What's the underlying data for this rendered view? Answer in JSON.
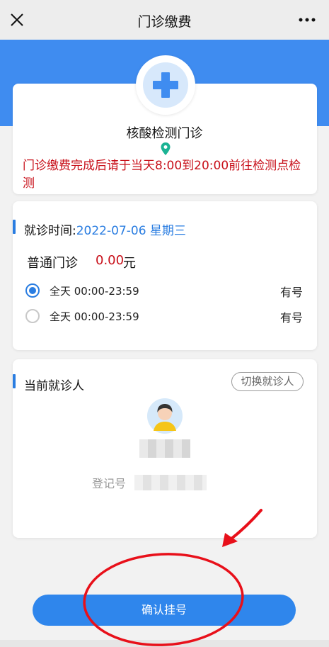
{
  "navbar": {
    "title": "门诊缴费",
    "close_icon": "close-icon",
    "more_icon": "more-icon"
  },
  "hospital": {
    "badge_icon": "medical-cross-icon",
    "clinic_name": "核酸检测门诊",
    "location_icon": "location-pin-icon",
    "notice": "门诊缴费完成后请于当天8:00到20:00前往检测点检测"
  },
  "schedule": {
    "visit_time_label": "就诊时间:",
    "visit_date": "2022-07-06 星期三",
    "clinic_type": "普通门诊",
    "price": "0.00",
    "price_unit": "元",
    "slots": [
      {
        "time": "全天 00:00-23:59",
        "status": "有号",
        "selected": true
      },
      {
        "time": "全天 00:00-23:59",
        "status": "有号",
        "selected": false
      }
    ]
  },
  "patient": {
    "title": "当前就诊人",
    "switch_label": "切换就诊人",
    "avatar_icon": "user-avatar-icon",
    "reg_label": "登记号"
  },
  "footer": {
    "confirm_label": "确认挂号"
  },
  "colors": {
    "primary": "#2f86ec",
    "banner": "#3f8cf0",
    "notice_red": "#c8101a",
    "annotation_red": "#e8101a"
  }
}
